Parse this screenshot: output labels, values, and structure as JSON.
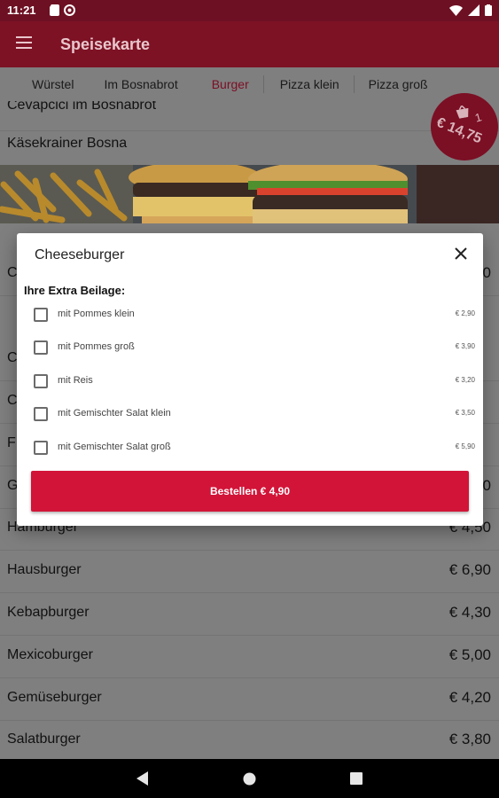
{
  "status": {
    "time": "11:21"
  },
  "appbar": {
    "title": "Speisekarte"
  },
  "tabs": [
    {
      "label": "Würstel"
    },
    {
      "label": "Im Bosnabrot"
    },
    {
      "label": "Burger"
    },
    {
      "label": "Pizza klein"
    },
    {
      "label": "Pizza groß"
    }
  ],
  "list": {
    "partial_top": {
      "name": "Cevapcici im Bosnabrot"
    },
    "items_before_banner": [
      {
        "name": "Käsekrainer Bosna"
      }
    ],
    "partial_hidden_letters": [
      "C",
      "C",
      "C",
      "F",
      "G"
    ],
    "partial_hidden_prices": [
      "0",
      "0"
    ],
    "items": [
      {
        "name": "Hamburger",
        "price": "€ 4,50"
      },
      {
        "name": "Hausburger",
        "price": "€ 6,90"
      },
      {
        "name": "Kebapburger",
        "price": "€ 4,30"
      },
      {
        "name": "Mexicoburger",
        "price": "€ 5,00"
      },
      {
        "name": "Gemüseburger",
        "price": "€ 4,20"
      },
      {
        "name": "Salatburger",
        "price": "€ 3,80"
      }
    ]
  },
  "cart": {
    "count": "1",
    "total": "€ 14,75"
  },
  "dialog": {
    "title": "Cheeseburger",
    "section": "Ihre Extra Beilage:",
    "options": [
      {
        "label": "mit Pommes klein",
        "price": "€ 2,90"
      },
      {
        "label": "mit Pommes groß",
        "price": "€ 3,90"
      },
      {
        "label": "mit Reis",
        "price": "€ 3,20"
      },
      {
        "label": "mit Gemischter Salat klein",
        "price": "€ 3,50"
      },
      {
        "label": "mit Gemischter Salat groß",
        "price": "€ 5,90"
      }
    ],
    "order_label": "Bestellen € 4,90"
  },
  "colors": {
    "primary": "#7d1224",
    "accent": "#d21438",
    "statusbar": "#6e1023"
  }
}
